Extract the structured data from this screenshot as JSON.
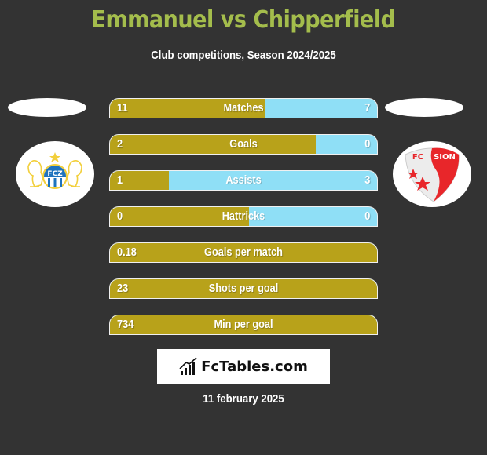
{
  "header": {
    "title": "Emmanuel vs Chipperfield",
    "subtitle": "Club competitions, Season 2024/2025"
  },
  "teams": {
    "left": {
      "name": "FC Zürich",
      "logo_text": "FCZ",
      "icon": "fcz-crest-icon"
    },
    "right": {
      "name": "FC Sion",
      "logo_text": "FC SION",
      "icon": "fc-sion-shield-icon"
    }
  },
  "colors": {
    "left_bar": "#b8a21a",
    "right_bar": "#8fdff6",
    "title": "#a4bd4c",
    "background": "#333333"
  },
  "stats": [
    {
      "label": "Matches",
      "left": "11",
      "right": "7",
      "left_share": 0.58
    },
    {
      "label": "Goals",
      "left": "2",
      "right": "0",
      "left_share": 0.77
    },
    {
      "label": "Assists",
      "left": "1",
      "right": "3",
      "left_share": 0.22
    },
    {
      "label": "Hattricks",
      "left": "0",
      "right": "0",
      "left_share": 0.52
    },
    {
      "label": "Goals per match",
      "left": "0.18",
      "right": "",
      "left_share": 1.0
    },
    {
      "label": "Shots per goal",
      "left": "23",
      "right": "",
      "left_share": 1.0
    },
    {
      "label": "Min per goal",
      "left": "734",
      "right": "",
      "left_share": 1.0
    }
  ],
  "footer": {
    "brand": "FcTables.com",
    "date": "11 february 2025"
  }
}
